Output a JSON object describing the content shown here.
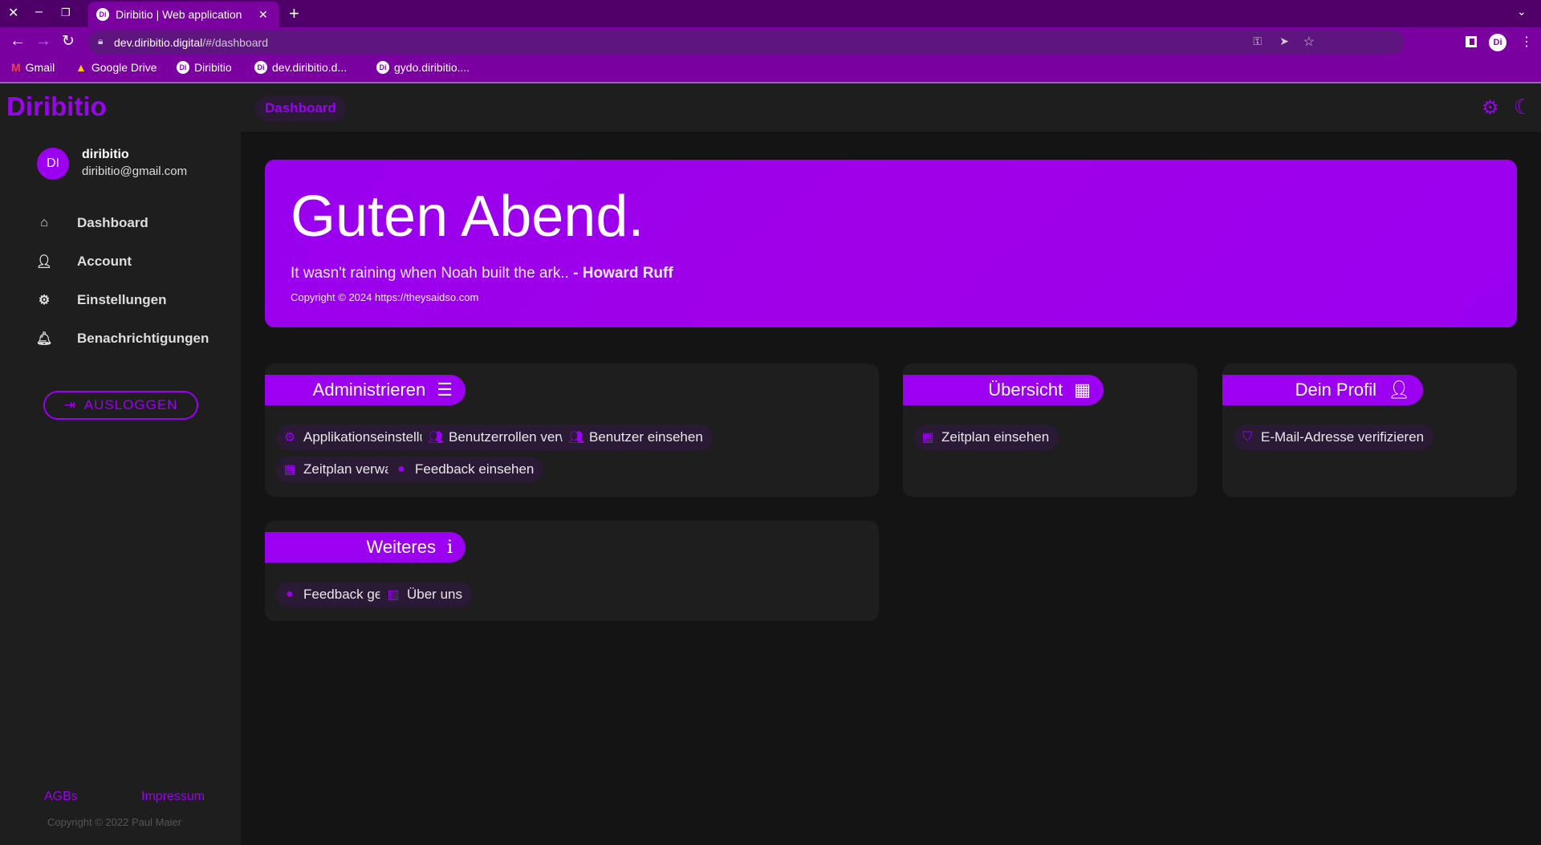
{
  "browser": {
    "tab_title": "Diribitio | Web application",
    "url_host": "dev.diribitio.digital",
    "url_path": "/#/dashboard",
    "bookmarks": [
      {
        "label": "Gmail",
        "icon": "gmail-icon"
      },
      {
        "label": "Google Drive",
        "icon": "drive-icon"
      },
      {
        "label": "Diribitio",
        "icon": "diribitio-icon"
      },
      {
        "label": "dev.diribitio.d...",
        "icon": "diribitio-icon"
      },
      {
        "label": "gydo.diribitio....",
        "icon": "diribitio-icon"
      }
    ],
    "profile_initials": "Di"
  },
  "app": {
    "logo": "Diribitio",
    "breadcrumb": "Dashboard",
    "accent": "#9b00f0"
  },
  "user": {
    "initials": "DI",
    "name": "diribitio",
    "email": "diribitio@gmail.com"
  },
  "sidebar": {
    "items": [
      {
        "label": "Dashboard",
        "icon": "home-icon"
      },
      {
        "label": "Account",
        "icon": "user-icon"
      },
      {
        "label": "Einstellungen",
        "icon": "gear-icon"
      },
      {
        "label": "Benachrichtigungen",
        "icon": "bell-icon"
      }
    ],
    "logout": "AUSLOGGEN",
    "footer": {
      "agb": "AGBs",
      "impressum": "Impressum",
      "copyright": "Copyright © 2022 Paul Maier"
    }
  },
  "hero": {
    "greeting": "Guten Abend.",
    "quote": "It wasn't raining when Noah built the ark..",
    "author": "- Howard Ruff",
    "copyright": "Copyright © 2024 https://theysaidso.com"
  },
  "cards": {
    "admin": {
      "title": "Administrieren",
      "items": [
        "Applikationseinstellungen",
        "Benutzerrollen verwalten",
        "Benutzer einsehen",
        "Zeitplan verwalten",
        "Feedback einsehen"
      ]
    },
    "overview": {
      "title": "Übersicht",
      "items": [
        "Zeitplan einsehen"
      ]
    },
    "profile": {
      "title": "Dein Profil",
      "items": [
        "E-Mail-Adresse verifizieren"
      ]
    },
    "more": {
      "title": "Weiteres",
      "items": [
        "Feedback geben",
        "Über uns"
      ]
    }
  }
}
